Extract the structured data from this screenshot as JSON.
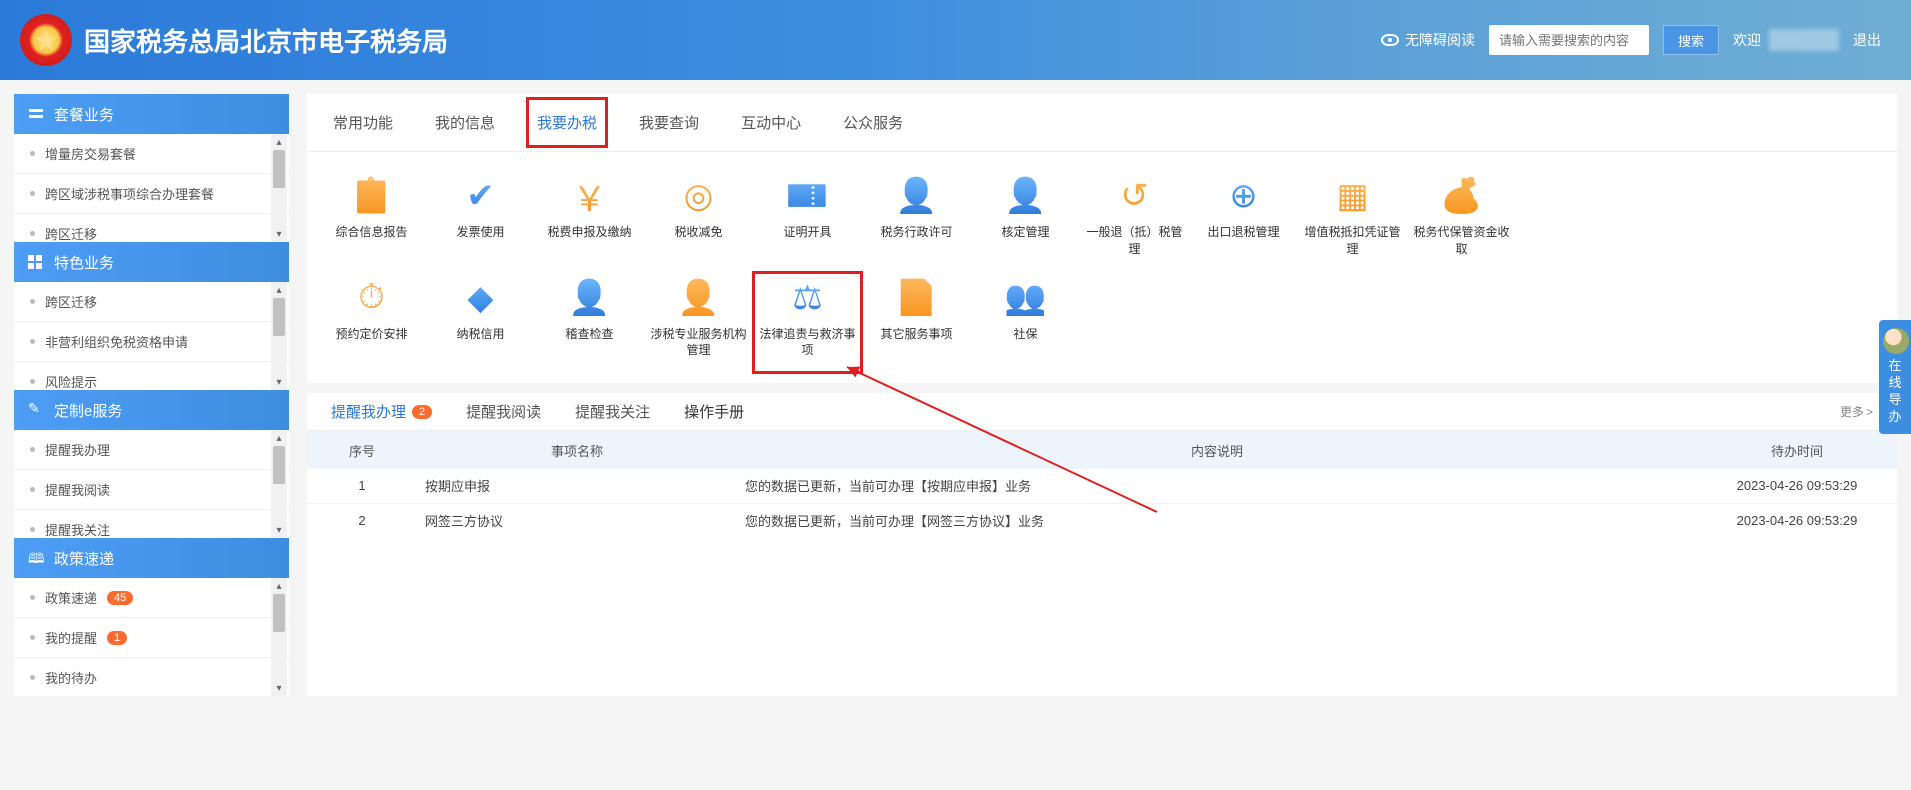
{
  "header": {
    "title": "国家税务总局北京市电子税务局",
    "accessibility": "无障碍阅读",
    "search_placeholder": "请输入需要搜索的内容",
    "search_btn": "搜索",
    "welcome": "欢迎",
    "logout": "退出"
  },
  "sidebar": {
    "groups": [
      {
        "title": "套餐业务",
        "icon": "layers",
        "scrollable": true,
        "items": [
          {
            "label": "增量房交易套餐"
          },
          {
            "label": "跨区域涉税事项综合办理套餐"
          },
          {
            "label": "跨区迁移"
          }
        ]
      },
      {
        "title": "特色业务",
        "icon": "grid",
        "scrollable": true,
        "items": [
          {
            "label": "跨区迁移"
          },
          {
            "label": "非营利组织免税资格申请"
          },
          {
            "label": "风险提示"
          }
        ]
      },
      {
        "title": "定制e服务",
        "icon": "wrench",
        "scrollable": true,
        "items": [
          {
            "label": "提醒我办理"
          },
          {
            "label": "提醒我阅读"
          },
          {
            "label": "提醒我关注"
          }
        ]
      },
      {
        "title": "政策速递",
        "icon": "paper",
        "scrollable": true,
        "items": [
          {
            "label": "政策速递",
            "badge": "45"
          },
          {
            "label": "我的提醒",
            "badge": "1"
          },
          {
            "label": "我的待办"
          }
        ]
      }
    ]
  },
  "main_tabs": [
    {
      "label": "常用功能"
    },
    {
      "label": "我的信息"
    },
    {
      "label": "我要办税",
      "active": true,
      "highlight": true
    },
    {
      "label": "我要查询"
    },
    {
      "label": "互动中心"
    },
    {
      "label": "公众服务"
    }
  ],
  "services_row1": [
    {
      "label": "综合信息报告",
      "glyph": "📋",
      "cls": "gi"
    },
    {
      "label": "发票使用",
      "glyph": "✔",
      "cls": "gb"
    },
    {
      "label": "税费申报及缴纳",
      "glyph": "￥",
      "cls": "gi"
    },
    {
      "label": "税收减免",
      "glyph": "◎",
      "cls": "gi"
    },
    {
      "label": "证明开具",
      "glyph": "🎫",
      "cls": "gb"
    },
    {
      "label": "税务行政许可",
      "glyph": "👤",
      "cls": "gb"
    },
    {
      "label": "核定管理",
      "glyph": "👤",
      "cls": "gb"
    },
    {
      "label": "一般退（抵）税管理",
      "glyph": "↺",
      "cls": "gi"
    },
    {
      "label": "出口退税管理",
      "glyph": "⊕",
      "cls": "gb"
    },
    {
      "label": "增值税抵扣凭证管理",
      "glyph": "▦",
      "cls": "gi"
    },
    {
      "label": "税务代保管资金收取",
      "glyph": "💰",
      "cls": "gi"
    }
  ],
  "services_row2": [
    {
      "label": "预约定价安排",
      "glyph": "⏱",
      "cls": "gi"
    },
    {
      "label": "纳税信用",
      "glyph": "◆",
      "cls": "gb"
    },
    {
      "label": "稽查检查",
      "glyph": "👤",
      "cls": "gb"
    },
    {
      "label": "涉税专业服务机构管理",
      "glyph": "👤",
      "cls": "gi"
    },
    {
      "label": "法律追责与救济事项",
      "glyph": "⚖",
      "cls": "gb",
      "highlight": true
    },
    {
      "label": "其它服务事项",
      "glyph": "📄",
      "cls": "gi"
    },
    {
      "label": "社保",
      "glyph": "👥",
      "cls": "gb"
    }
  ],
  "reminder_tabs": [
    {
      "label": "提醒我办理",
      "badge": "2",
      "active": true
    },
    {
      "label": "提醒我阅读"
    },
    {
      "label": "提醒我关注"
    },
    {
      "label": "操作手册",
      "dark": true
    }
  ],
  "more_label": "更多",
  "table": {
    "headers": {
      "no": "序号",
      "name": "事项名称",
      "desc": "内容说明",
      "time": "待办时间"
    },
    "rows": [
      {
        "no": "1",
        "name": "按期应申报",
        "desc": "您的数据已更新，当前可办理【按期应申报】业务",
        "time": "2023-04-26 09:53:29"
      },
      {
        "no": "2",
        "name": "网签三方协议",
        "desc": "您的数据已更新，当前可办理【网签三方协议】业务",
        "time": "2023-04-26 09:53:29"
      }
    ]
  },
  "float_help": "在线导办"
}
